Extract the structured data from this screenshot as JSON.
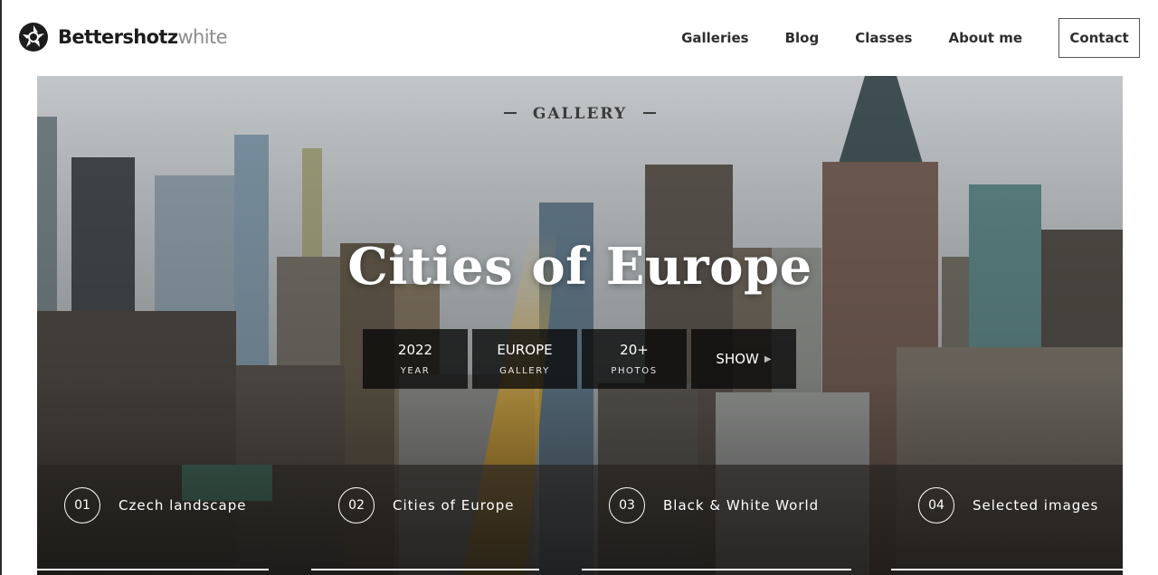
{
  "brand": {
    "name_bold": "Bettershotz",
    "name_light": "white",
    "icon": "aperture-icon"
  },
  "nav": {
    "items": [
      "Galleries",
      "Blog",
      "Classes",
      "About me"
    ],
    "contact_label": "Contact"
  },
  "hero": {
    "eyebrow": "GALLERY",
    "title": "Cities of Europe",
    "stats": [
      {
        "value": "2022",
        "label": "YEAR"
      },
      {
        "value": "EUROPE",
        "label": "GALLERY"
      },
      {
        "value": "20+",
        "label": "PHOTOS"
      }
    ],
    "show_label": "SHOW",
    "show_icon": "play-arrow-icon",
    "background": "city skyline photo"
  },
  "gallery_tabs": [
    {
      "number": "01",
      "label": "Czech landscape"
    },
    {
      "number": "02",
      "label": "Cities of Europe"
    },
    {
      "number": "03",
      "label": "Black & White World"
    },
    {
      "number": "04",
      "label": "Selected images"
    }
  ],
  "colors": {
    "text_dark": "#2e2e2e",
    "overlay": "#080808",
    "white": "#ffffff"
  }
}
